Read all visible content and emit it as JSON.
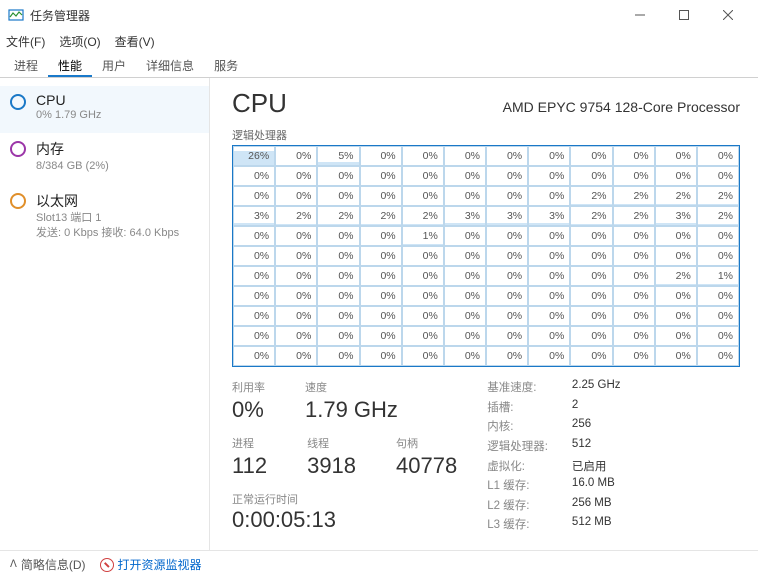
{
  "window": {
    "title": "任务管理器"
  },
  "menu": {
    "file": "文件(F)",
    "options": "选项(O)",
    "view": "查看(V)"
  },
  "tabs": [
    "进程",
    "性能",
    "用户",
    "详细信息",
    "服务"
  ],
  "activeTab": 1,
  "sidebar": {
    "cpu": {
      "title": "CPU",
      "sub": "0% 1.79 GHz"
    },
    "mem": {
      "title": "内存",
      "sub": "8/384 GB (2%)"
    },
    "eth": {
      "title": "以太网",
      "sub1": "Slot13 端口 1",
      "sub2": "发送: 0 Kbps 接收: 64.0 Kbps"
    }
  },
  "main": {
    "title": "CPU",
    "desc": "AMD EPYC 9754 128-Core Processor",
    "gridLabel": "逻辑处理器",
    "cores": [
      [
        26,
        0,
        5,
        0,
        0,
        0,
        0,
        0,
        0,
        0,
        0,
        0
      ],
      [
        0,
        0,
        0,
        0,
        0,
        0,
        0,
        0,
        0,
        0,
        0,
        0
      ],
      [
        0,
        0,
        0,
        0,
        0,
        0,
        0,
        0,
        2,
        2,
        2,
        2
      ],
      [
        3,
        2,
        2,
        2,
        2,
        3,
        3,
        3,
        2,
        2,
        3,
        2
      ],
      [
        0,
        0,
        0,
        0,
        1,
        0,
        0,
        0,
        0,
        0,
        0,
        0
      ],
      [
        0,
        0,
        0,
        0,
        0,
        0,
        0,
        0,
        0,
        0,
        0,
        0
      ],
      [
        0,
        0,
        0,
        0,
        0,
        0,
        0,
        0,
        0,
        0,
        2,
        1
      ],
      [
        0,
        0,
        0,
        0,
        0,
        0,
        0,
        0,
        0,
        0,
        0,
        0
      ],
      [
        0,
        0,
        0,
        0,
        0,
        0,
        0,
        0,
        0,
        0,
        0,
        0
      ],
      [
        0,
        0,
        0,
        0,
        0,
        0,
        0,
        0,
        0,
        0,
        0,
        0
      ],
      [
        0,
        0,
        0,
        0,
        0,
        0,
        0,
        0,
        0,
        0,
        0,
        0
      ]
    ],
    "stats": {
      "util_lbl": "利用率",
      "util": "0%",
      "speed_lbl": "速度",
      "speed": "1.79 GHz",
      "proc_lbl": "进程",
      "proc": "112",
      "thr_lbl": "线程",
      "thr": "3918",
      "hnd_lbl": "句柄",
      "hnd": "40778",
      "uptime_lbl": "正常运行时间",
      "uptime": "0:00:05:13"
    },
    "info": {
      "k0": "基准速度:",
      "v0": "2.25 GHz",
      "k1": "插槽:",
      "v1": "2",
      "k2": "内核:",
      "v2": "256",
      "k3": "逻辑处理器:",
      "v3": "512",
      "k4": "虚拟化:",
      "v4": "已启用",
      "k5": "L1 缓存:",
      "v5": "16.0 MB",
      "k6": "L2 缓存:",
      "v6": "256 MB",
      "k7": "L3 缓存:",
      "v7": "512 MB"
    }
  },
  "footer": {
    "brief": "简略信息(D)",
    "resmon": "打开资源监视器"
  }
}
